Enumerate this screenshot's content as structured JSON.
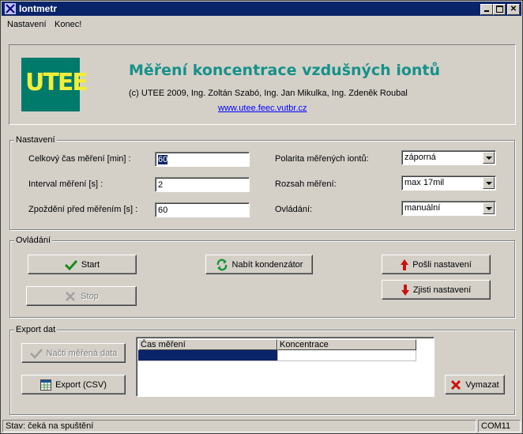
{
  "window": {
    "title": "Iontmetr"
  },
  "menu": {
    "items": [
      "Nastavení",
      "Konec!"
    ]
  },
  "header": {
    "logo_text": "UTEE",
    "title": "Měření koncentrace vzdušných iontů",
    "credits": "(c) UTEE 2009, Ing. Zoltán Szabó, Ing. Jan Mikulka, Ing. Zdeněk Roubal",
    "link": "www.utee.feec.vutbr.cz"
  },
  "settings": {
    "legend": "Nastavení",
    "total_time_label": "Celkový čas měření [min] :",
    "total_time_value": "60",
    "interval_label": "Interval měření [s] :",
    "interval_value": "2",
    "delay_label": "Zpoždění před měřením [s] :",
    "delay_value": "60",
    "polarity_label": "Polarita měřených iontů:",
    "polarity_value": "záporná",
    "range_label": "Rozsah měření:",
    "range_value": "max 17mil",
    "control_label": "Ovládání:",
    "control_value": "manuální"
  },
  "control": {
    "legend": "Ovládání",
    "start": "Start",
    "stop": "Stop",
    "charge": "Nabít kondenzátor",
    "send_settings": "Pošli nastavení",
    "get_settings": "Zjisti nastavení"
  },
  "export": {
    "legend": "Export dat",
    "load": "Načti měřená data",
    "export_csv": "Export (CSV)",
    "clear": "Vymazat",
    "columns": [
      "Čas měření",
      "Koncentrace"
    ]
  },
  "status": {
    "text": "Stav: čeká na spuštění",
    "port": "COM11"
  },
  "colors": {
    "titlebar": "#0a246a",
    "headline": "#16918a",
    "logo_bg": "#007a6a",
    "logo_text": "#f2ee3a",
    "selected_row": "#0a246a"
  }
}
